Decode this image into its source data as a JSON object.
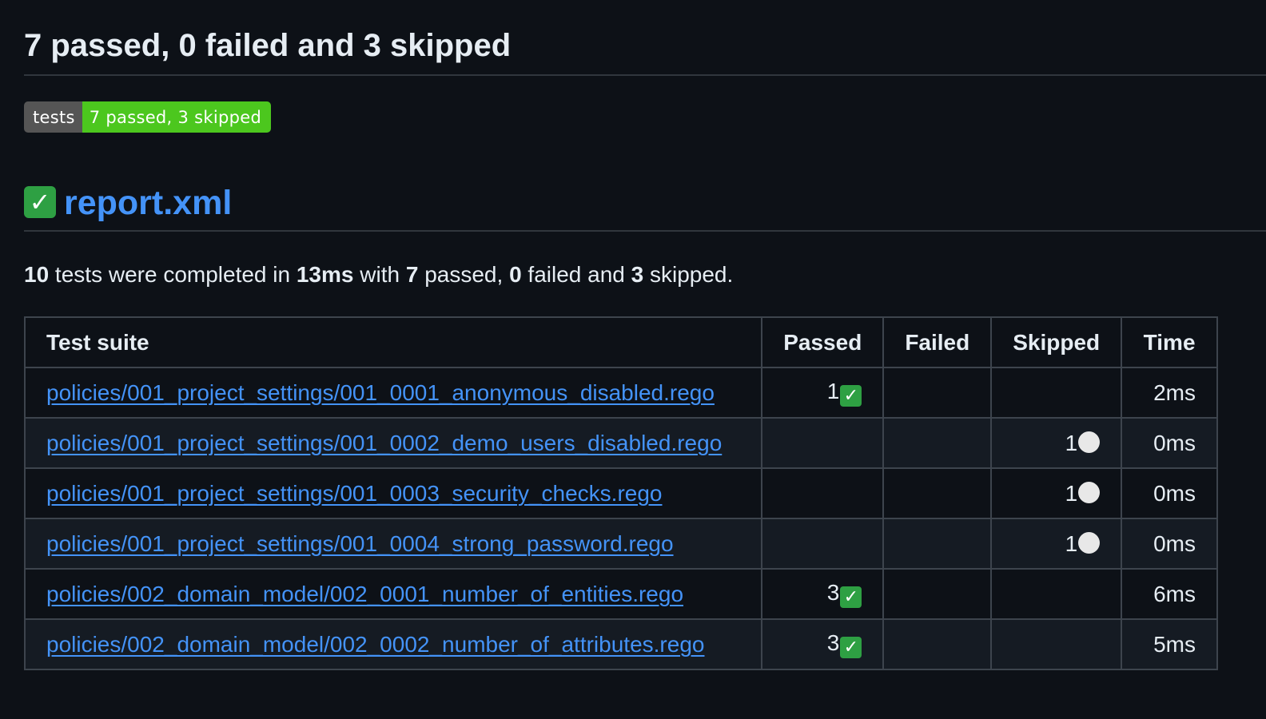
{
  "summary": {
    "title": "7 passed, 0 failed and 3 skipped"
  },
  "badge": {
    "label": "tests",
    "value": "7 passed, 3 skipped",
    "label_color": "#555555",
    "value_color": "#4cc71e"
  },
  "report": {
    "status_icon": "check-mark-button-icon",
    "link_text": "report.xml"
  },
  "stats": {
    "total": "10",
    "text_1": " tests were completed in ",
    "duration": "13ms",
    "text_2": " with ",
    "passed": "7",
    "text_3": " passed, ",
    "failed": "0",
    "text_4": " failed and ",
    "skipped": "3",
    "text_5": " skipped."
  },
  "table": {
    "headers": {
      "suite": "Test suite",
      "passed": "Passed",
      "failed": "Failed",
      "skipped": "Skipped",
      "time": "Time"
    },
    "rows": [
      {
        "suite": "policies/001_project_settings/001_0001_anonymous_disabled.rego",
        "passed": "1",
        "failed": "",
        "skipped": "",
        "time": "2ms"
      },
      {
        "suite": "policies/001_project_settings/001_0002_demo_users_disabled.rego",
        "passed": "",
        "failed": "",
        "skipped": "1",
        "time": "0ms"
      },
      {
        "suite": "policies/001_project_settings/001_0003_security_checks.rego",
        "passed": "",
        "failed": "",
        "skipped": "1",
        "time": "0ms"
      },
      {
        "suite": "policies/001_project_settings/001_0004_strong_password.rego",
        "passed": "",
        "failed": "",
        "skipped": "1",
        "time": "0ms"
      },
      {
        "suite": "policies/002_domain_model/002_0001_number_of_entities.rego",
        "passed": "3",
        "failed": "",
        "skipped": "",
        "time": "6ms"
      },
      {
        "suite": "policies/002_domain_model/002_0002_number_of_attributes.rego",
        "passed": "3",
        "failed": "",
        "skipped": "",
        "time": "5ms"
      }
    ]
  },
  "colors": {
    "background": "#0d1117",
    "link": "#4493f8",
    "passed_icon": "#2ea043",
    "skipped_icon": "#e8e8e8"
  }
}
